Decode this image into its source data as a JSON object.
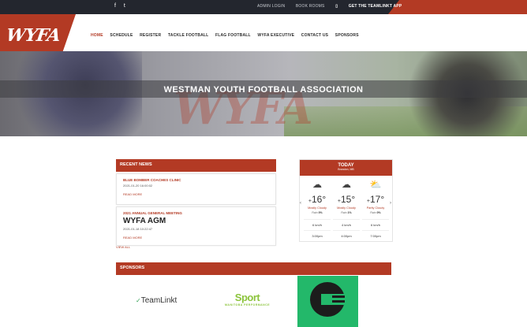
{
  "topbar": {
    "social": [
      "f",
      "t"
    ],
    "links": [
      "ADMIN LOGIN",
      "BOOK ROOMS"
    ],
    "app_label": "GET THE TEAMLINKT APP"
  },
  "logo": {
    "text": "WYFA"
  },
  "nav": {
    "items": [
      "HOME",
      "SCHEDULE",
      "REGISTER",
      "TACKLE FOOTBALL",
      "FLAG FOOTBALL",
      "WYFA EXECUTIVE",
      "CONTACT US",
      "SPONSORS"
    ],
    "active": "HOME"
  },
  "hero": {
    "title": "WESTMAN YOUTH FOOTBALL ASSOCIATION",
    "watermark": "WYFA"
  },
  "news": {
    "heading": "RECENT NEWS",
    "items": [
      {
        "title": "BLUE BOMBER COACHES CLINIC",
        "date": "2021-01-20 16:00:02",
        "more": "READ MORE"
      },
      {
        "title": "2021 ANNUAL GENERAL MEETING",
        "headline": "WYFA AGM",
        "date": "2021-01-18 10:22:47",
        "more": "READ MORE"
      }
    ],
    "view_all": "VIEW ALL"
  },
  "weather": {
    "heading": "TODAY",
    "location": "Brandon, MB",
    "forecast": [
      {
        "temp": "16°",
        "sign": "+",
        "condition": "Mostly Cloudy",
        "rain_label": "Rain",
        "rain": "0%",
        "wind": "6 km/h",
        "time": "3:00pm"
      },
      {
        "temp": "15°",
        "sign": "+",
        "condition": "Mostly Cloudy",
        "rain_label": "Rain",
        "rain": "1%",
        "wind": "4 km/h",
        "time": "4:00pm"
      },
      {
        "temp": "17°",
        "sign": "+",
        "condition": "Partly Cloudy",
        "rain_label": "Rain",
        "rain": "0%",
        "wind": "6 km/h",
        "time": "7:00pm"
      }
    ]
  },
  "sponsors": {
    "heading": "SPONSORS",
    "items": [
      {
        "name": "TeamLinkt"
      },
      {
        "name": "Sport",
        "sub": "MANITOBA PERFORMANCE"
      },
      {
        "name": ""
      }
    ]
  },
  "colors": {
    "accent": "#b33a24",
    "topbar": "#23262e",
    "sponsor_green": "#23b86a"
  }
}
